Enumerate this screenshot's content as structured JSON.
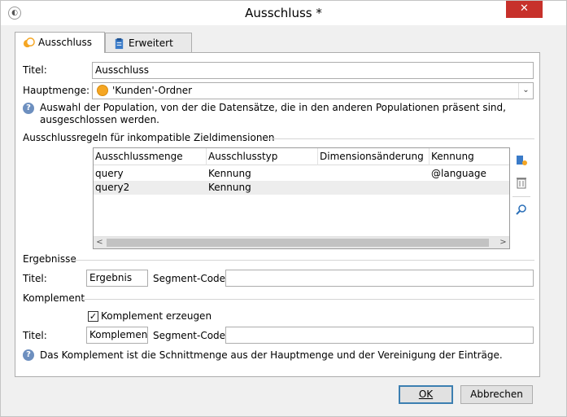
{
  "window": {
    "title": "Ausschluss *",
    "close_glyph": "✕"
  },
  "tabs": [
    {
      "label": "Ausschluss",
      "icon": "exclusion-icon",
      "active": true
    },
    {
      "label": "Erweitert",
      "icon": "clipboard-icon",
      "active": false
    }
  ],
  "form": {
    "title_label": "Titel:",
    "title_value": "Ausschluss",
    "main_set_label": "Hauptmenge:",
    "main_set_value": "'Kunden'-Ordner",
    "help_text": "Auswahl der Population, von der die Datensätze, die in den anderen Populationen präsent sind, ausgeschlossen werden."
  },
  "rules": {
    "section_label": "Ausschlussregeln für inkompatible Zieldimensionen",
    "columns": [
      "Ausschlussmenge",
      "Ausschlusstyp",
      "Dimensionsänderung",
      "Kennung"
    ],
    "rows": [
      {
        "set": "query",
        "type": "Kennung",
        "dim_change": "",
        "id": "@language"
      },
      {
        "set": "query2",
        "type": "Kennung",
        "dim_change": "",
        "id": ""
      }
    ]
  },
  "results": {
    "section_label": "Ergebnisse",
    "title_label": "Titel:",
    "title_value": "Ergebnis",
    "segment_label": "Segment-Code:",
    "segment_value": ""
  },
  "complement": {
    "section_label": "Komplement",
    "checkbox_label": "Komplement erzeugen",
    "checked": true,
    "title_label": "Titel:",
    "title_value": "Komplement",
    "segment_label": "Segment-Code:",
    "segment_value": "",
    "help_text": "Das Komplement ist die Schnittmenge aus der Hauptmenge und der Vereinigung der Einträge."
  },
  "buttons": {
    "ok": "OK",
    "cancel": "Abbrechen"
  },
  "colors": {
    "close_red": "#c7312b",
    "accent_orange": "#f5a623",
    "help_blue": "#6d8fbf"
  }
}
